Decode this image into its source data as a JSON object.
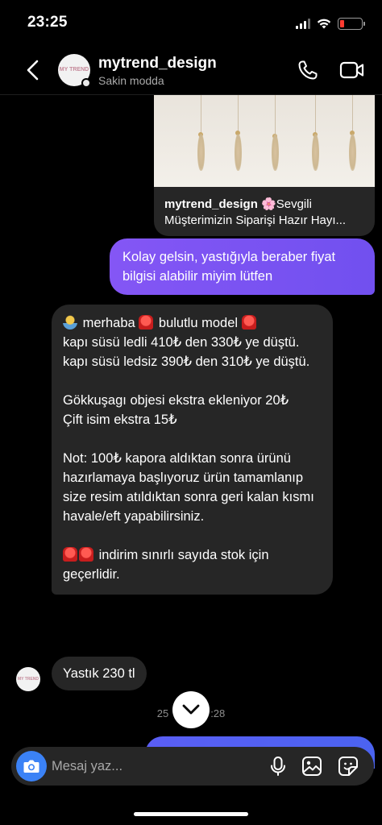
{
  "status_bar": {
    "time": "23:25",
    "battery_level": 0.2,
    "battery_color": "#ff3b30"
  },
  "header": {
    "name": "mytrend_design",
    "status": "Sakin modda",
    "avatar_text": "MY TREND",
    "icons": [
      "back-chevron-icon",
      "phone-icon",
      "video-camera-icon"
    ]
  },
  "messages": {
    "shared_post": {
      "author": "mytrend_design",
      "emoji": "🌸",
      "text": "Sevgili Müşterimizin Siparişi Hazır Hayı..."
    },
    "outgoing_1": "Kolay gelsin, yastığıyla beraber fiyat bilgisi alabilir miyim lütfen",
    "incoming_long": {
      "line1": "merhaba",
      "line1b": "bulutlu model",
      "line2": "kapı süsü ledli 410₺ den 330₺ ye düştü.",
      "line3": "kapı süsü ledsiz 390₺ den 310₺ ye düştü.",
      "line4": "Gökkuşagı objesi ekstra ekleniyor 20₺",
      "line5": "Çift isim ekstra 15₺",
      "line6": "Not: 100₺ kapora aldıktan sonra ürünü hazırlamaya başlıyoruz ürün tamamlanıp size resim atıldıktan sonra geri kalan kısmı havale/eft yapabilirsiniz.",
      "line7": "indirim sınırlı sayıda stok için geçerlidir."
    },
    "incoming_short": "Yastık 230 tl",
    "timestamp_left": "25",
    "timestamp_right": ":28"
  },
  "composer": {
    "placeholder": "Mesaj yaz...",
    "icons": [
      "camera-icon",
      "microphone-icon",
      "gallery-icon",
      "sticker-icon"
    ]
  },
  "colors": {
    "outgoing_bubble": "#7a4cf0",
    "incoming_bubble": "#262626",
    "camera_button": "#3b82f6"
  }
}
